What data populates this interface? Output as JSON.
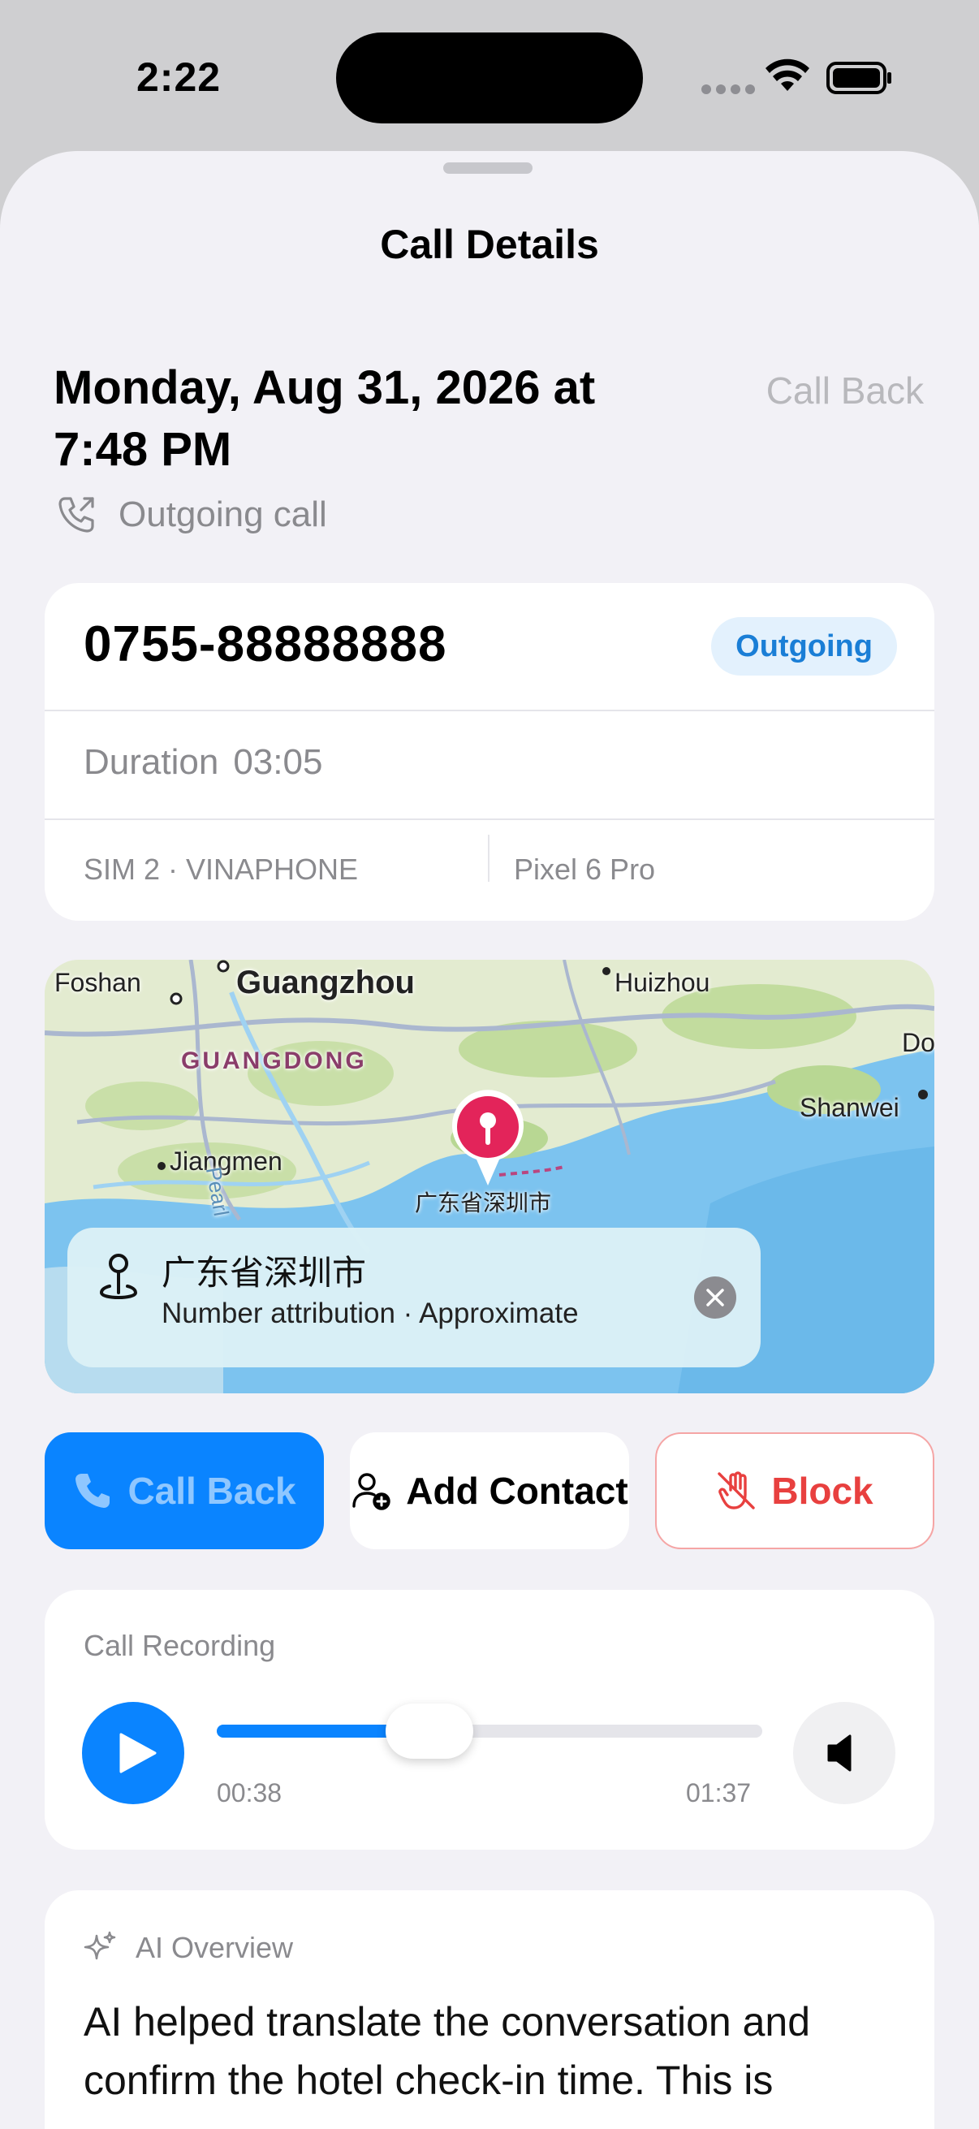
{
  "status_bar": {
    "time": "2:22"
  },
  "sheet": {
    "title": "Call Details"
  },
  "header": {
    "date_line1": "Monday, Aug 31, 2026 at",
    "date_line2": "7:48 PM",
    "call_back_label": "Call Back",
    "call_type": "Outgoing call"
  },
  "info": {
    "number": "0755-88888888",
    "badge": "Outgoing",
    "duration_label": "Duration",
    "duration_value": "03:05",
    "sim": "SIM 2 · VINAPHONE",
    "device": "Pixel 6 Pro"
  },
  "map": {
    "labels": {
      "foshan": "Foshan",
      "guangzhou": "Guangzhou",
      "huizhou": "Huizhou",
      "guangdong": "GUANGDONG",
      "jiangmen": "Jiangmen",
      "shanwei": "Shanwei",
      "do": "Do",
      "pearl": "Pearl",
      "shenzhen": "广东省深圳市"
    },
    "location_name": "广东省深圳市",
    "location_sub": "Number attribution · Approximate"
  },
  "actions": {
    "call_back": "Call Back",
    "add_contact": "Add Contact",
    "block": "Block"
  },
  "recording": {
    "title": "Call Recording",
    "elapsed": "00:38",
    "total": "01:37",
    "progress": 0.39
  },
  "ai": {
    "title": "AI Overview",
    "text": "AI helped translate the conversation and confirm the hotel check-in time. This is"
  },
  "colors": {
    "accent": "#0a84ff",
    "block_red": "#e8403f",
    "badge_bg": "#e3f1fd",
    "sheet_bg": "#f2f1f6"
  }
}
